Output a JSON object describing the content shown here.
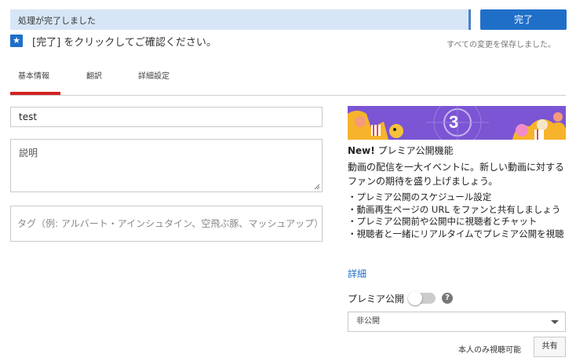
{
  "upload": {
    "progress_text": "処理が完了しました",
    "progress_percent": 100,
    "done_label": "完了"
  },
  "notice": {
    "icon": "star-icon",
    "text": "[完了] をクリックしてご確認ください。",
    "saved_status": "すべての変更を保存しました。"
  },
  "tabs": [
    {
      "label": "基本情報",
      "active": true
    },
    {
      "label": "翻訳",
      "active": false
    },
    {
      "label": "詳細設定",
      "active": false
    }
  ],
  "form": {
    "title_value": "test",
    "description_placeholder": "説明",
    "tags_placeholder": "タグ（例: アルバート・アインシュタイン、空飛ぶ豚、マッシュアップ）"
  },
  "premiere": {
    "banner_number": "3",
    "title_prefix": "New!",
    "title": " プレミア公開機能",
    "description": "動画の配信を一大イベントに。新しい動画に対するファンの期待を盛り上げましょう。",
    "features": [
      "・プレミア公開のスケジュール設定",
      "・動画再生ページの URL をファンと共有しましょう",
      "・プレミア公開前や公開中に視聴者とチャット",
      "・視聴者と一緒にリアルタイムでプレミア公開を視聴"
    ],
    "details_link": "詳細",
    "toggle_label": "プレミア公開",
    "toggle_on": false
  },
  "visibility": {
    "selected": "非公開",
    "note": "本人のみ視聴可能",
    "share_label": "共有"
  },
  "colors": {
    "accent_blue": "#1f6fc9",
    "active_tab_red": "#d32222",
    "progress_bg": "#d7e6f7",
    "banner_purple": "#7b55d3"
  }
}
